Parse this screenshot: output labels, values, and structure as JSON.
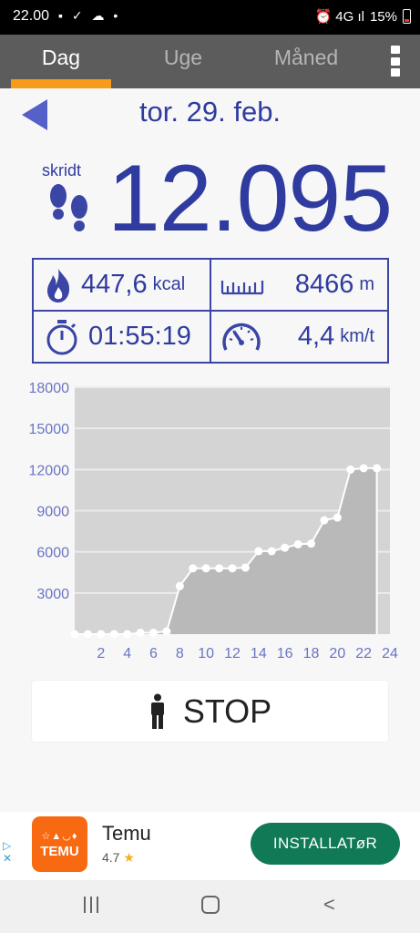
{
  "status_bar": {
    "time": "22.00",
    "left_icons": "▪ ✓ ☁ •",
    "right_icons": "⏰ 4G ıl",
    "battery": "15%"
  },
  "tabs": [
    {
      "label": "Dag",
      "active": true
    },
    {
      "label": "Uge",
      "active": false
    },
    {
      "label": "Måned",
      "active": false
    }
  ],
  "header": {
    "date": "tor. 29. feb."
  },
  "steps": {
    "label": "skridt",
    "value": "12.095"
  },
  "stats": {
    "calories": {
      "value": "447,6",
      "unit": "kcal",
      "icon": "flame-icon"
    },
    "distance": {
      "value": "8466",
      "unit": "m",
      "icon": "ruler-icon"
    },
    "duration": {
      "value": "01:55:19",
      "icon": "stopwatch-icon"
    },
    "speed": {
      "value": "4,4",
      "unit": "km/t",
      "icon": "speedometer-icon"
    }
  },
  "chart_data": {
    "type": "area",
    "x": [
      0,
      1,
      2,
      3,
      4,
      5,
      6,
      7,
      8,
      9,
      10,
      11,
      12,
      13,
      14,
      15,
      16,
      17,
      18,
      19,
      20,
      21,
      22,
      23
    ],
    "values": [
      0,
      0,
      0,
      0,
      0,
      100,
      100,
      200,
      3500,
      4800,
      4800,
      4800,
      4800,
      4850,
      6050,
      6050,
      6300,
      6550,
      6600,
      8300,
      8500,
      12000,
      12095,
      12095
    ],
    "xticks": [
      "2",
      "4",
      "6",
      "8",
      "10",
      "12",
      "14",
      "16",
      "18",
      "20",
      "22",
      "24"
    ],
    "yticks": [
      "3000",
      "6000",
      "9000",
      "12000",
      "15000",
      "18000"
    ],
    "xlim": [
      0,
      24
    ],
    "ylim": [
      0,
      18000
    ],
    "grid": true,
    "colors": {
      "plot_bg": "#d4d4d4",
      "area": "#b9b9b9",
      "line": "#ffffff",
      "tick": "#6a74c4"
    }
  },
  "stop_button": {
    "label": "STOP"
  },
  "ad": {
    "app_name": "Temu",
    "rating": "4.7",
    "logo_glyphs": "☆▲◡♦",
    "logo_text": "TEMU",
    "install_label": "INSTALLATøR"
  }
}
